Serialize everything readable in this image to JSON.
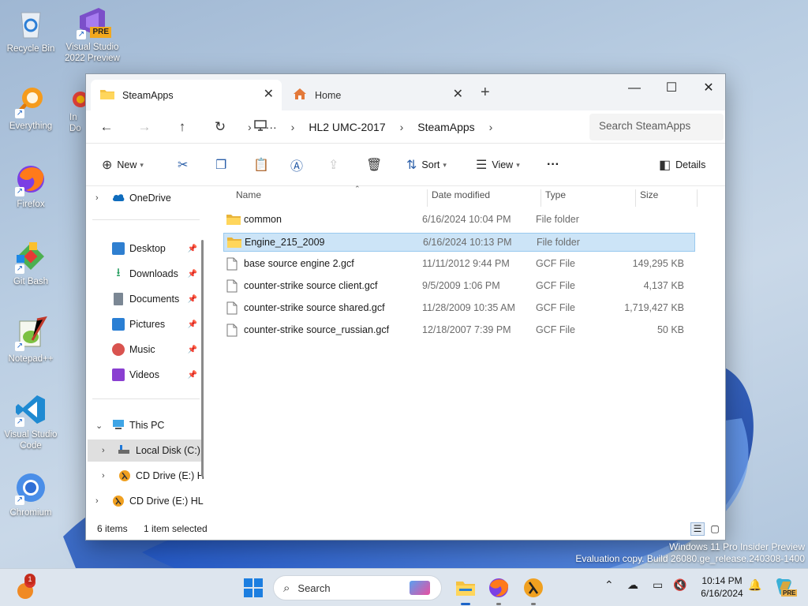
{
  "desktop": {
    "icons": [
      {
        "label": "Recycle Bin",
        "icon": "recycle-bin-icon"
      },
      {
        "label": "Visual Studio 2022 Preview",
        "icon": "visual-studio-preview-icon",
        "badge": "PRE"
      },
      {
        "label": "Everything",
        "icon": "everything-search-icon"
      },
      {
        "label": "In Do",
        "icon": "partial-icon"
      },
      {
        "label": "Firefox",
        "icon": "firefox-icon"
      },
      {
        "label": "Git Bash",
        "icon": "git-bash-icon"
      },
      {
        "label": "Notepad++",
        "icon": "notepad-plus-plus-icon"
      },
      {
        "label": "Visual Studio Code",
        "icon": "vscode-icon"
      },
      {
        "label": "Chromium",
        "icon": "chromium-icon"
      }
    ],
    "watermark_line1": "Windows 11 Pro Insider Preview",
    "watermark_line2": "Evaluation copy. Build 26080.ge_release.240308-1400"
  },
  "window": {
    "tabs": [
      {
        "label": "SteamApps",
        "icon": "folder-icon",
        "active": true
      },
      {
        "label": "Home",
        "icon": "home-icon",
        "active": false
      }
    ],
    "controls": {
      "minimize": "—",
      "maximize": "☐",
      "close": "✕"
    },
    "address": {
      "breadcrumbs": [
        "HL2 UMC-2017",
        "SteamApps"
      ],
      "overflow": "···",
      "search_placeholder": "Search SteamApps"
    },
    "commands": {
      "new": "New",
      "sort": "Sort",
      "view": "View",
      "more": "···",
      "details": "Details"
    },
    "nav": {
      "onedrive": "OneDrive",
      "quick": [
        {
          "label": "Desktop",
          "icon": "desktop-icon",
          "color": "#2f7fd0"
        },
        {
          "label": "Downloads",
          "icon": "download-icon",
          "color": "#1f9a5b"
        },
        {
          "label": "Documents",
          "icon": "documents-icon",
          "color": "#7b8794"
        },
        {
          "label": "Pictures",
          "icon": "pictures-icon",
          "color": "#2a7fd4"
        },
        {
          "label": "Music",
          "icon": "music-icon",
          "color": "#d9534f"
        },
        {
          "label": "Videos",
          "icon": "videos-icon",
          "color": "#8a3fd1"
        }
      ],
      "this_pc": "This PC",
      "local_disk": "Local Disk (C:)",
      "cd_drive_1": "CD Drive (E:) H",
      "cd_drive_2": "CD Drive (E:) HL"
    },
    "columns": {
      "name": "Name",
      "date": "Date modified",
      "type": "Type",
      "size": "Size"
    },
    "files": [
      {
        "name": "common",
        "date": "6/16/2024 10:04 PM",
        "type": "File folder",
        "size": "",
        "kind": "folder"
      },
      {
        "name": "Engine_215_2009",
        "date": "6/16/2024 10:13 PM",
        "type": "File folder",
        "size": "",
        "kind": "folder",
        "selected": true
      },
      {
        "name": "base source engine 2.gcf",
        "date": "11/11/2012 9:44 PM",
        "type": "GCF File",
        "size": "149,295 KB",
        "kind": "file"
      },
      {
        "name": "counter-strike source client.gcf",
        "date": "9/5/2009 1:06 PM",
        "type": "GCF File",
        "size": "4,137 KB",
        "kind": "file"
      },
      {
        "name": "counter-strike source shared.gcf",
        "date": "11/28/2009 10:35 AM",
        "type": "GCF File",
        "size": "1,719,427 KB",
        "kind": "file"
      },
      {
        "name": "counter-strike source_russian.gcf",
        "date": "12/18/2007 7:39 PM",
        "type": "GCF File",
        "size": "50 KB",
        "kind": "file"
      }
    ],
    "status": {
      "count": "6 items",
      "selection": "1 item selected"
    }
  },
  "taskbar": {
    "search_label": "Search",
    "notification_count": "1",
    "time": "10:14 PM",
    "date": "6/16/2024"
  }
}
